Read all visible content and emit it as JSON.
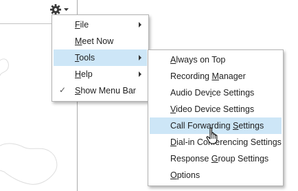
{
  "main_menu": {
    "items": [
      {
        "label": "File",
        "mnemonic": "F",
        "rest": "ile",
        "submenu": true
      },
      {
        "label": "Meet Now",
        "mnemonic": "M",
        "rest": "eet Now",
        "submenu": false
      },
      {
        "label": "Tools",
        "mnemonic": "T",
        "rest": "ools",
        "submenu": true,
        "highlighted": true
      },
      {
        "label": "Help",
        "mnemonic": "H",
        "rest": "elp",
        "submenu": true
      },
      {
        "label": "Show Menu Bar",
        "mnemonic": "S",
        "rest": "how Menu Bar",
        "checked": true
      }
    ]
  },
  "tools_submenu": {
    "items": [
      {
        "label": "Always on Top",
        "pre": "",
        "mnemonic": "A",
        "post": "lways on Top"
      },
      {
        "label": "Recording Manager",
        "pre": "Recording ",
        "mnemonic": "M",
        "post": "anager"
      },
      {
        "label": "Audio Device Settings",
        "pre": "Audio Dev",
        "mnemonic": "i",
        "post": "ce Settings"
      },
      {
        "label": "Video Device Settings",
        "pre": "",
        "mnemonic": "V",
        "post": "ideo Device Settings"
      },
      {
        "label": "Call Forwarding Settings",
        "pre": "Call Forwarding ",
        "mnemonic": "S",
        "post": "ettings",
        "highlighted": true
      },
      {
        "label": "Dial-in Conferencing Settings",
        "pre": "",
        "mnemonic": "D",
        "post": "ial-in Conferencing Settings"
      },
      {
        "label": "Response Group Settings",
        "pre": "Response ",
        "mnemonic": "G",
        "post": "roup Settings"
      },
      {
        "label": "Options",
        "pre": "",
        "mnemonic": "O",
        "post": "ptions"
      }
    ]
  },
  "colors": {
    "highlight": "#cde6f7",
    "border": "#b2b2b2",
    "background": "#ffffff"
  },
  "icons": {
    "gear": "gear-icon",
    "dropdown": "chevron-down-icon",
    "check": "checkmark-icon",
    "cursor": "hand-pointer-icon"
  }
}
